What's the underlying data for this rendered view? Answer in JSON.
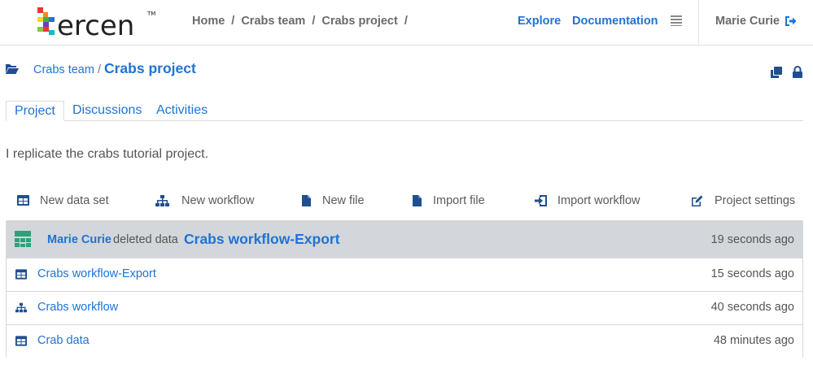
{
  "colors": {
    "accent": "#1e73d6",
    "icon_blue": "#1f4f8f",
    "highlight_row": "#d3d6da",
    "avatar_green": "#2aa37a"
  },
  "navbar": {
    "logo_text": "tercen",
    "logo_tm": "™",
    "breadcrumb": [
      "Home",
      "Crabs team",
      "Crabs project"
    ],
    "separator": "/",
    "explore": "Explore",
    "documentation": "Documentation",
    "menu_icon": "hamburger-icon",
    "user": "Marie Curie",
    "logout_icon": "sign-out-icon"
  },
  "project": {
    "team": "Crabs team",
    "separator": "/",
    "name": "Crabs project",
    "description": "I replicate the crabs tutorial project."
  },
  "tabs": [
    {
      "label": "Project",
      "active": true
    },
    {
      "label": "Discussions",
      "active": false
    },
    {
      "label": "Activities",
      "active": false
    }
  ],
  "actions": [
    {
      "label": "New data set",
      "icon": "table-icon"
    },
    {
      "label": "New workflow",
      "icon": "sitemap-icon"
    },
    {
      "label": "New file",
      "icon": "file-icon"
    },
    {
      "label": "Import file",
      "icon": "file-icon"
    },
    {
      "label": "Import workflow",
      "icon": "import-icon"
    },
    {
      "label": "Project settings",
      "icon": "edit-icon"
    }
  ],
  "activity": {
    "user": "Marie Curie",
    "verb": "deleted data",
    "target": "Crabs workflow-Export",
    "time": "19 seconds ago"
  },
  "items": [
    {
      "name": "Crabs workflow-Export",
      "icon": "table-icon",
      "time": "15 seconds ago"
    },
    {
      "name": "Crabs workflow",
      "icon": "sitemap-icon",
      "time": "40 seconds ago"
    },
    {
      "name": "Crab data",
      "icon": "table-icon",
      "time": "48 minutes ago"
    }
  ]
}
